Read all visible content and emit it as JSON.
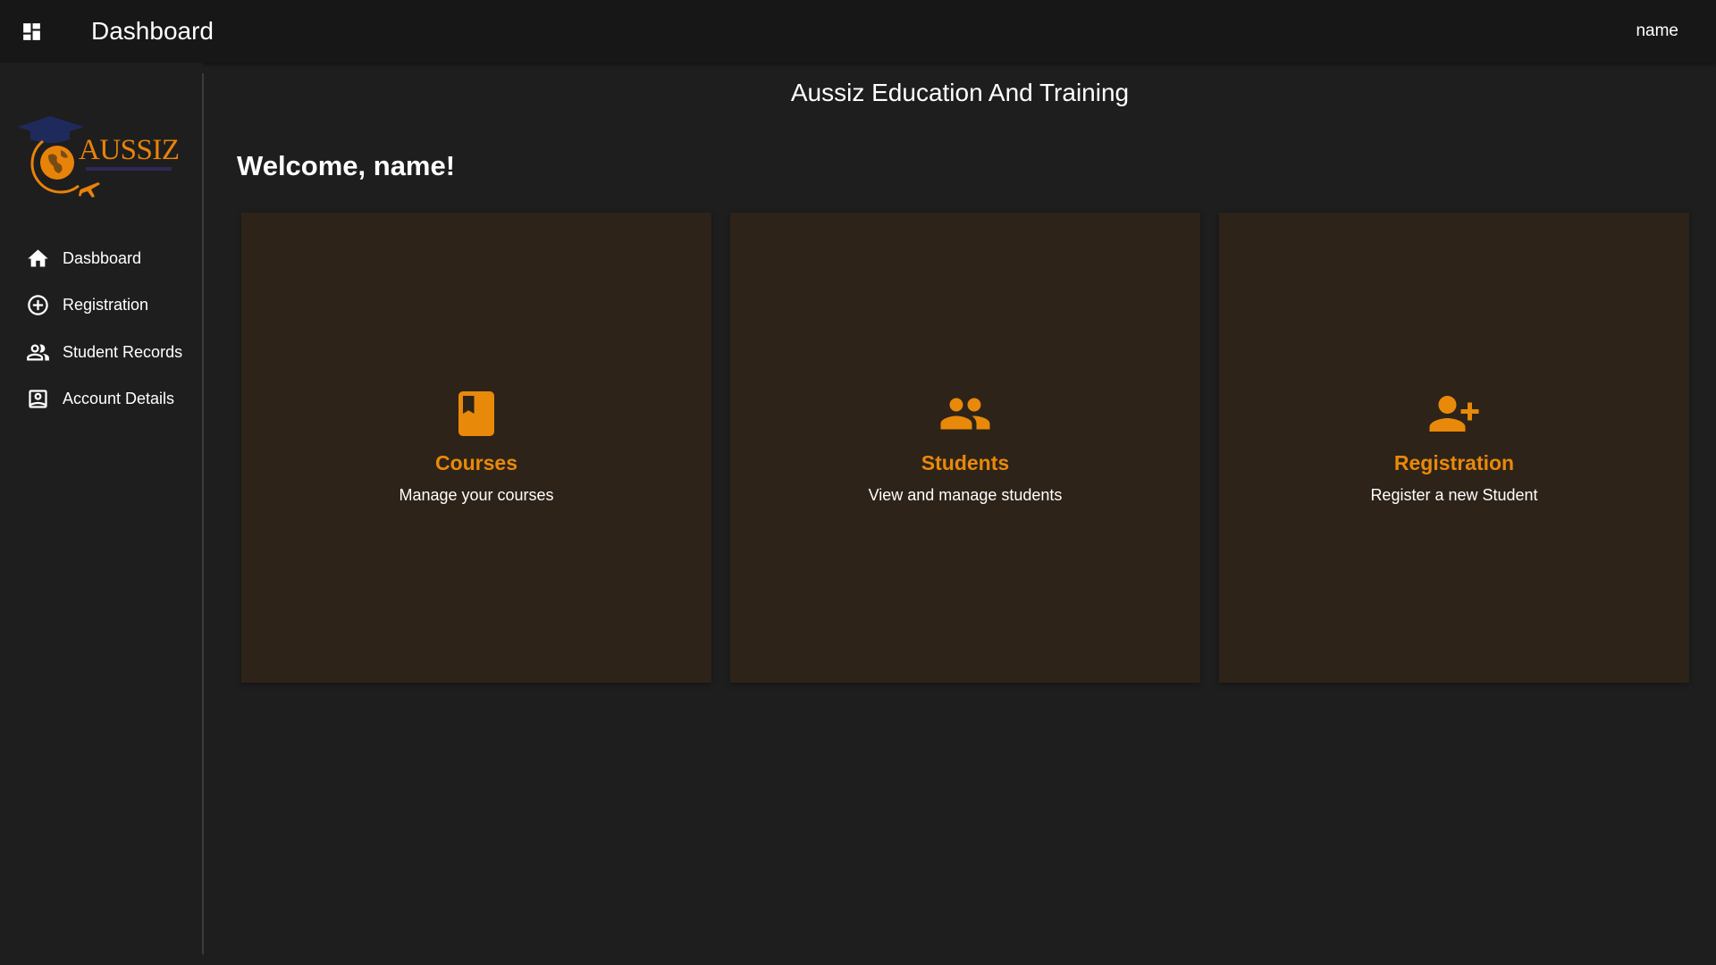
{
  "appbar": {
    "title": "Dashboard",
    "user": "name",
    "menu_icon": "dashboard-grid-icon"
  },
  "logo": {
    "text": "AUSSIZ",
    "colors": {
      "orange": "#e8830a",
      "navy": "#1f2a5c"
    }
  },
  "sidebar": {
    "items": [
      {
        "label": "Dasbboard",
        "icon": "home-icon"
      },
      {
        "label": "Registration",
        "icon": "add-circle-icon"
      },
      {
        "label": "Student Records",
        "icon": "people-icon"
      },
      {
        "label": "Account Details",
        "icon": "account-box-icon"
      }
    ]
  },
  "main": {
    "org_title": "Aussiz Education And Training",
    "welcome": "Welcome, name!",
    "cards": [
      {
        "title": "Courses",
        "description": "Manage your courses",
        "icon": "book-icon"
      },
      {
        "title": "Students",
        "description": "View and manage students",
        "icon": "people-icon"
      },
      {
        "title": "Registration",
        "description": "Register a new Student",
        "icon": "person-add-icon"
      }
    ]
  },
  "colors": {
    "background": "#1e1e1e",
    "appbar": "#171717",
    "card_background": "#2d2319",
    "accent": "#e8890a",
    "text": "#ffffff"
  }
}
